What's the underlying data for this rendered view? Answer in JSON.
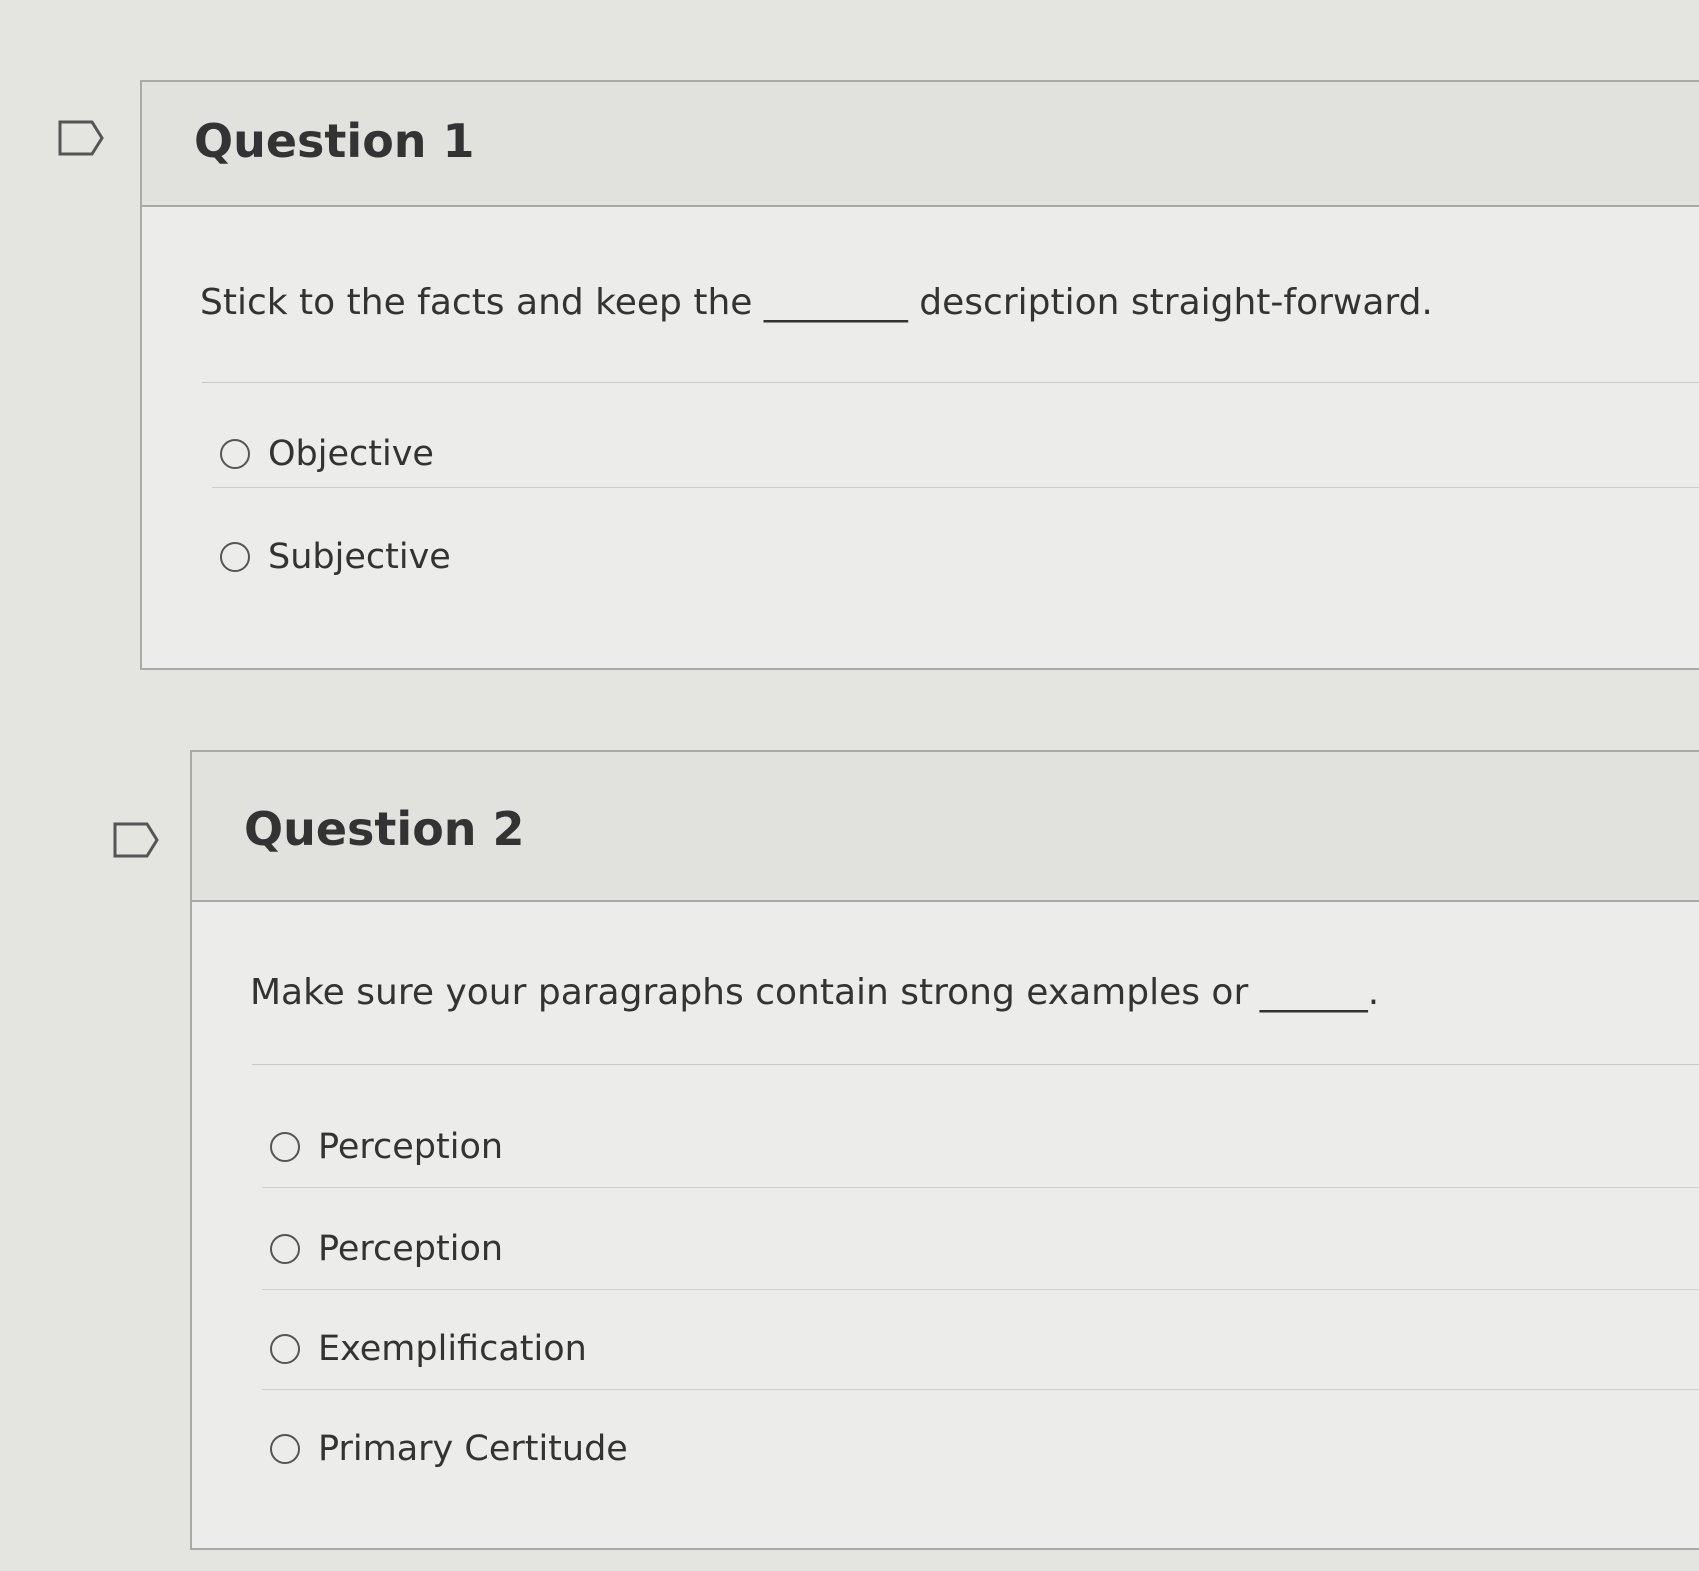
{
  "questions": [
    {
      "title": "Question 1",
      "text": "Stick to the facts and keep the ________ description straight-forward.",
      "answers": [
        {
          "label": "Objective"
        },
        {
          "label": "Subjective"
        }
      ]
    },
    {
      "title": "Question 2",
      "text": "Make sure your paragraphs contain strong examples or ______.",
      "answers": [
        {
          "label": "Perception"
        },
        {
          "label": "Perception"
        },
        {
          "label": "Exemplification"
        },
        {
          "label": "Primary Certitude"
        }
      ]
    }
  ]
}
